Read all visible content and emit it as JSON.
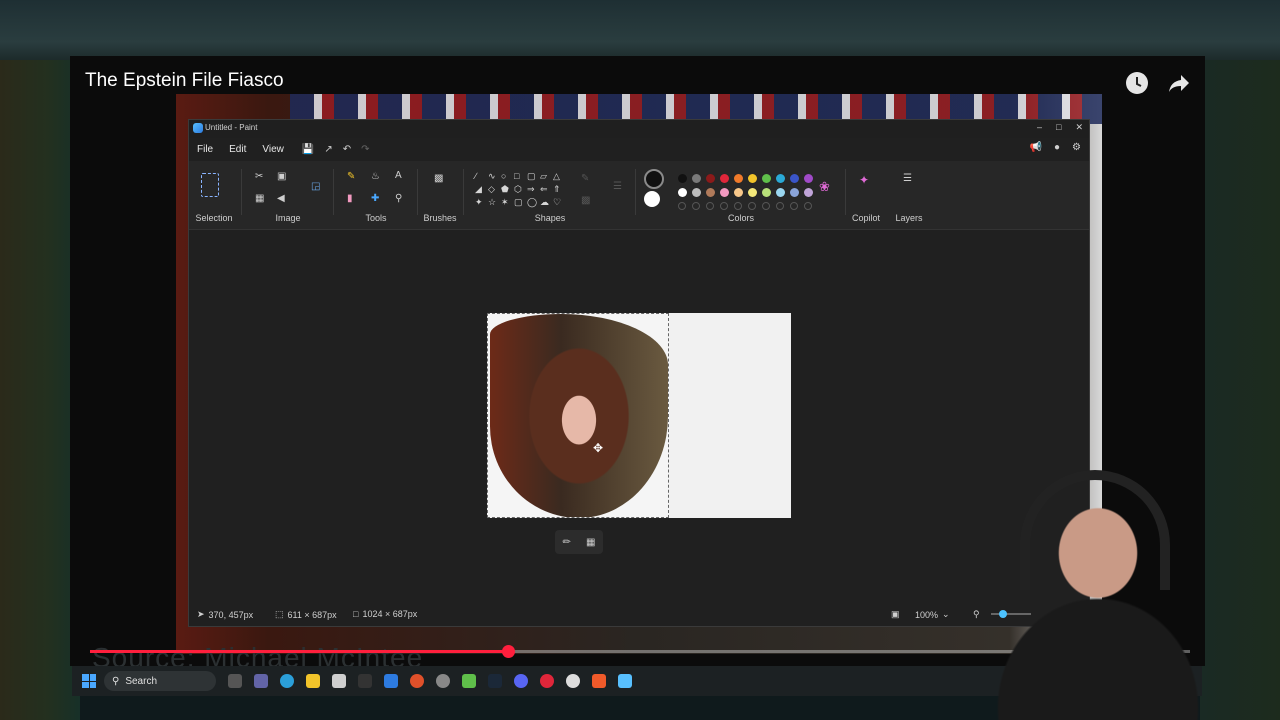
{
  "video": {
    "title": "The Epstein File Fiasco",
    "caption": "Source: Michael McIntee",
    "progress_fraction": 0.38,
    "icons": [
      "clock-icon",
      "share-icon"
    ]
  },
  "paint": {
    "window_title": "Untitled - Paint",
    "menu": [
      "File",
      "Edit",
      "View"
    ],
    "ribbon_groups": {
      "selection": "Selection",
      "image": "Image",
      "tools": "Tools",
      "brushes": "Brushes",
      "shapes": "Shapes",
      "colors": "Colors",
      "copilot": "Copilot",
      "layers": "Layers"
    },
    "palette_row1": [
      "#111111",
      "#7a7a7a",
      "#8b1a1a",
      "#e0263a",
      "#f07a2a",
      "#f2c42a",
      "#5fbf4a",
      "#2aa9d6",
      "#3a55c8",
      "#a04ac8"
    ],
    "palette_row2": [
      "#ffffff",
      "#bdbdbd",
      "#b07a5a",
      "#f29ac0",
      "#f8c88a",
      "#f4e87a",
      "#b8e07a",
      "#9ad6f0",
      "#8aa4d8",
      "#c0a4d8"
    ],
    "primary_color": "#111111",
    "secondary_color": "#ffffff",
    "status": {
      "cursor_pos": "370, 457px",
      "selection_size": "611 × 687px",
      "canvas_size": "1024 × 687px",
      "zoom": "100%"
    }
  },
  "taskbar": {
    "search_placeholder": "Search"
  }
}
